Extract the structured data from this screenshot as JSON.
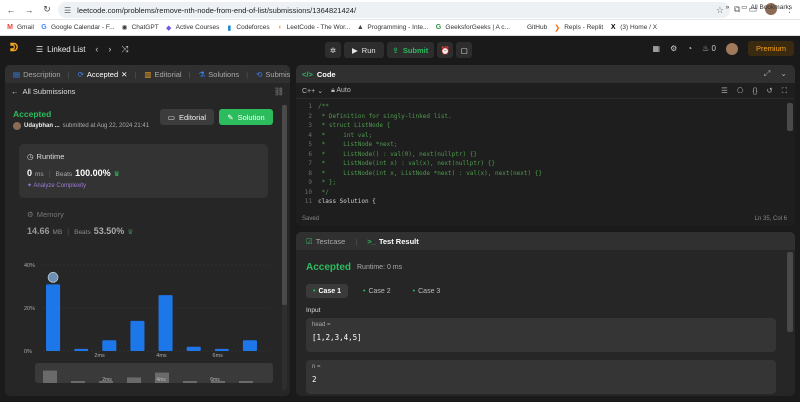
{
  "browser": {
    "url": "leetcode.com/problems/remove-nth-node-from-end-of-list/submissions/1364821424/",
    "bookmarks": [
      {
        "icon": "M",
        "label": "Gmail",
        "color": "#ea4335"
      },
      {
        "icon": "G",
        "label": "Google Calendar - F...",
        "color": "#4285f4"
      },
      {
        "icon": "✺",
        "label": "ChatGPT",
        "color": "#333333"
      },
      {
        "icon": "◆",
        "label": "Active Courses",
        "color": "#6c5ce7"
      },
      {
        "icon": "▮",
        "label": "Codeforces",
        "color": "#1f8acb"
      },
      {
        "icon": "◖",
        "label": "LeetCode - The Wor...",
        "color": "#f5a623"
      },
      {
        "icon": "▲",
        "label": "Programming - Inte...",
        "color": "#444444"
      },
      {
        "icon": "G",
        "label": "GeeksforGeeks | A c...",
        "color": "#2f8d46"
      },
      {
        "icon": "",
        "label": "GitHub",
        "color": "#333333"
      },
      {
        "icon": "❯",
        "label": "Repls - Replit",
        "color": "#f26207"
      },
      {
        "icon": "X",
        "label": "(3) Home / X",
        "color": "#000000"
      }
    ],
    "more_label": "»",
    "all_bookmarks": "All Bookmarks"
  },
  "nav": {
    "list_label": "Linked List",
    "run_label": "Run",
    "submit_label": "Submit",
    "streak": "0",
    "premium_label": "Premium"
  },
  "left": {
    "tabs": [
      {
        "label": "Description",
        "active": false
      },
      {
        "label": "Accepted",
        "active": true
      },
      {
        "label": "Editorial",
        "active": false
      },
      {
        "label": "Solutions",
        "active": false
      },
      {
        "label": "Submissions",
        "active": false
      }
    ],
    "all_submissions": "All Submissions",
    "status": "Accepted",
    "username": "Udaybhan ...",
    "submitted": "submitted at Aug 22, 2024 21:41",
    "editorial_btn": "Editorial",
    "solution_btn": "Solution",
    "runtime": {
      "label": "Runtime",
      "value": "0",
      "unit": "ms",
      "beats_label": "Beats",
      "beats": "100.00%",
      "analyze": "Analyze Complexity"
    },
    "memory": {
      "label": "Memory",
      "value": "14.66",
      "unit": "MB",
      "beats_label": "Beats",
      "beats": "53.50%"
    }
  },
  "chart_data": {
    "type": "bar",
    "title": "",
    "xlabel": "",
    "ylabel": "",
    "y_ticks": [
      "40%",
      "20%",
      "0%"
    ],
    "x_ticks": [
      "2ms",
      "4ms",
      "6ms"
    ],
    "ylim": [
      0,
      40
    ],
    "values": [
      31,
      1,
      5,
      14,
      26,
      2,
      1,
      5
    ],
    "highlight_index": 0,
    "color": "#1e77e8"
  },
  "minimap": {
    "x_ticks": [
      "2ms",
      "4ms",
      "6ms"
    ]
  },
  "code": {
    "title": "Code",
    "language": "C++",
    "mode": "Auto",
    "saved": "Saved",
    "position": "Ln 35, Col 6",
    "lines": [
      {
        "n": "1",
        "text": "/**"
      },
      {
        "n": "2",
        "text": " * Definition for singly-linked list."
      },
      {
        "n": "3",
        "text": " * struct ListNode {"
      },
      {
        "n": "4",
        "text": " *     int val;"
      },
      {
        "n": "5",
        "text": " *     ListNode *next;"
      },
      {
        "n": "6",
        "text": " *     ListNode() : val(0), next(nullptr) {}"
      },
      {
        "n": "7",
        "text": " *     ListNode(int x) : val(x), next(nullptr) {}"
      },
      {
        "n": "8",
        "text": " *     ListNode(int x, ListNode *next) : val(x), next(next) {}"
      },
      {
        "n": "9",
        "text": " * };"
      },
      {
        "n": "10",
        "text": " */"
      },
      {
        "n": "11",
        "text": "class Solution {"
      }
    ]
  },
  "result": {
    "tab_testcase": "Testcase",
    "tab_result": "Test Result",
    "status": "Accepted",
    "runtime": "Runtime: 0 ms",
    "cases": [
      "Case 1",
      "Case 2",
      "Case 3"
    ],
    "input_label": "Input",
    "head_label": "head =",
    "head_value": "[1,2,3,4,5]",
    "n_label": "n =",
    "n_value": "2"
  }
}
